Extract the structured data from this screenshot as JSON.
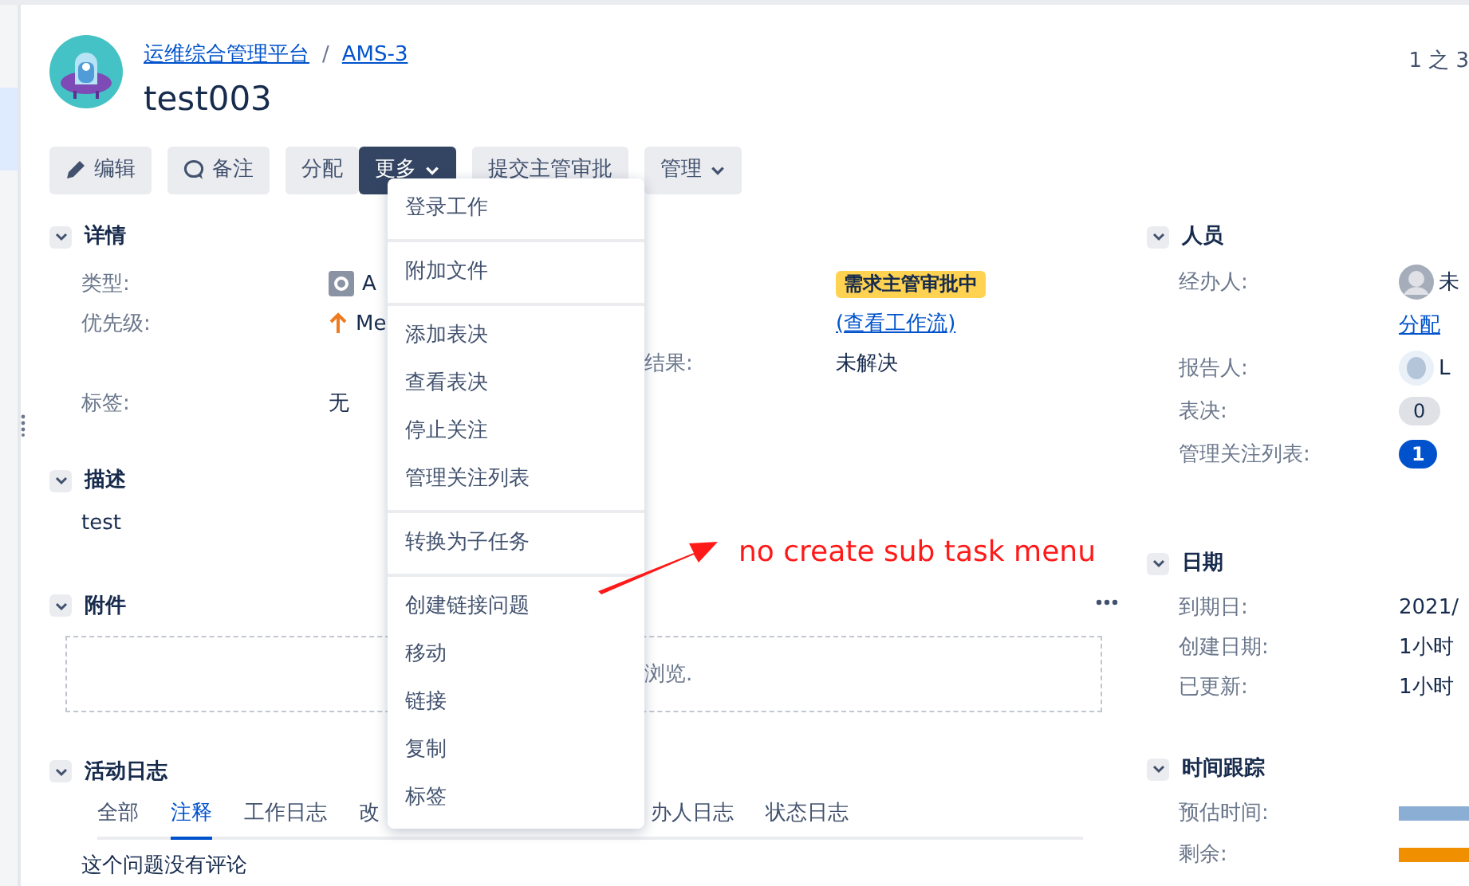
{
  "breadcrumb": [
    {
      "text": "运维综合管理平台"
    },
    {
      "text": "AMS-3"
    }
  ],
  "breadcrumb_separator": "/",
  "title": "test003",
  "pager": "1 之 3",
  "toolbar": [
    {
      "label": "编辑",
      "kind": "edit",
      "expanded": false
    },
    {
      "label": "备注",
      "kind": "comment",
      "expanded": false
    },
    {
      "label": "分配",
      "kind": "plain",
      "expanded": false
    },
    {
      "label": "更多",
      "kind": "dropdown",
      "expanded": true
    },
    {
      "label": "提交主管审批",
      "kind": "plain",
      "expanded": false
    },
    {
      "label": "管理",
      "kind": "dropdown",
      "expanded": false
    }
  ],
  "details": {
    "title": "详情",
    "expanded": true,
    "rows": [
      {
        "cells": [
          {
            "kind": "label",
            "text": "类型:"
          },
          {
            "kind": "issue-type",
            "text": "A"
          },
          {
            "kind": "empty"
          },
          {
            "kind": "status",
            "text": "需求主管审批中"
          }
        ]
      },
      {
        "cells": [
          {
            "kind": "label",
            "text": "优先级:"
          },
          {
            "kind": "priority",
            "text": "Me"
          },
          {
            "kind": "empty"
          },
          {
            "kind": "link",
            "text": "(查看工作流)"
          }
        ]
      },
      {
        "cells": [
          {
            "kind": "empty"
          },
          {
            "kind": "empty"
          },
          {
            "kind": "label",
            "text": "结果:"
          },
          {
            "kind": "value",
            "text": "未解决"
          }
        ]
      },
      {
        "cells": [
          {
            "kind": "label",
            "text": "标签:"
          },
          {
            "kind": "value",
            "text": "无"
          },
          {
            "kind": "empty"
          },
          {
            "kind": "empty"
          }
        ]
      }
    ]
  },
  "description": {
    "title": "描述",
    "expanded": true,
    "text": "test"
  },
  "attachments": {
    "title": "附件",
    "expanded": true,
    "drop_text": "浏览."
  },
  "activity": {
    "title": "活动日志",
    "expanded": true,
    "tabs": [
      {
        "label": "全部",
        "selected": false
      },
      {
        "label": "注释",
        "selected": true
      },
      {
        "label": "工作日志",
        "selected": false
      },
      {
        "label": "改",
        "selected": false
      },
      {
        "label": "办人日志",
        "selected": false
      },
      {
        "label": "状态日志",
        "selected": false
      }
    ],
    "empty_text": "这个问题没有评论"
  },
  "menu": {
    "groups": [
      [
        {
          "label": "登录工作"
        }
      ],
      [
        {
          "label": "附加文件"
        }
      ],
      [
        {
          "label": "添加表决"
        },
        {
          "label": "查看表决"
        },
        {
          "label": "停止关注"
        },
        {
          "label": "管理关注列表"
        }
      ],
      [
        {
          "label": "转换为子任务"
        }
      ],
      [
        {
          "label": "创建链接问题"
        },
        {
          "label": "移动"
        },
        {
          "label": "链接"
        },
        {
          "label": "复制"
        },
        {
          "label": "标签"
        }
      ]
    ]
  },
  "annotation": {
    "text": "no create sub task menu"
  },
  "people": {
    "title": "人员",
    "expanded": true,
    "rows": [
      {
        "label": "经办人:",
        "kind": "unknown-user",
        "value": "未"
      },
      {
        "kind": "link",
        "value": "分配"
      },
      {
        "label": "报告人:",
        "kind": "user",
        "value": "L"
      },
      {
        "label": "表决:",
        "kind": "pill",
        "value": "0"
      },
      {
        "label": "管理关注列表:",
        "kind": "count",
        "value": "1"
      }
    ]
  },
  "dates": {
    "title": "日期",
    "expanded": true,
    "rows": [
      {
        "label": "到期日:",
        "kind": "value",
        "value": "2021/"
      },
      {
        "label": "创建日期:",
        "kind": "value",
        "value": "1小时"
      },
      {
        "label": "已更新:",
        "kind": "value",
        "value": "1小时"
      }
    ]
  },
  "time_tracking": {
    "title": "时间跟踪",
    "expanded": true,
    "rows": [
      {
        "label": "预估时间:",
        "kind": "bar",
        "color": "#8aaed4"
      },
      {
        "label": "剩余:",
        "kind": "bar",
        "color": "#f09000"
      }
    ]
  }
}
